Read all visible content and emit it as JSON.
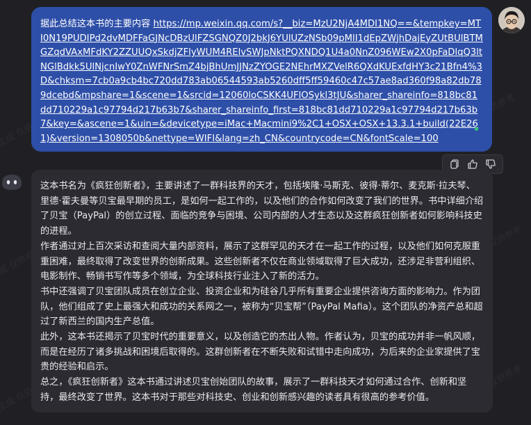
{
  "user_message": {
    "prompt": "据此总结这本书的主要内容 ",
    "url": "https://mp.weixin.qq.com/s?__biz=MzU2NjA4MDI1NQ==&tempkey=MTI0N19PUDIPd2dvMDFFaGJNcDBzUlFZSGNQZ0J2bkJ6YUlUZzNSb09pMlI1dEpZWjhDajEyZUtBUlBTMGZqdVAxMFdKY2ZZUUQxSkdjZFlyWUM4RElvSWJpNktPQXNDQ1U4a0NnZ096WEw2X0pFaDlqQ3ltNGlBdkk5UlNjcnIwY0ZnWFNrSmZ4bjBhUmJJNzZYOGE2NEhrMXZVelR6QXdKUExfdHY3c21Bfn4%3D&chksm=7cb0a9cb4bc720dd783ab06544593ab5260dff5ff59460c47c57ae8ad360f98a82db789dcebd&mpshare=1&scene=1&srcid=12060loCSKK4UFlOSykl3tJU&sharer_shareinfo=818bc81dd710229a1c97794d217b63b7&sharer_shareinfo_first=818bc81dd710229a1c97794d217b63b7&key=&ascene=1&uin=&devicetype=iMac+Macmini9%2C1+OSX+OSX+13.3.1+build(22E261)&version=1308050b&nettype=WIFI&lang=zh_CN&countrycode=CN&fontScale=100"
  },
  "bot_response": {
    "paragraphs": [
      "这本书名为《疯狂创新者》，主要讲述了一群科技界的天才，包括埃隆·马斯克、彼得·蒂尔、麦克斯·拉夫琴、里德·霍夫曼等贝宝最早期的员工，是如何一起工作的，以及他们的合作如何改变了我们的世界。书中详细介绍了贝宝（PayPal）的创立过程、面临的竞争与困境、公司内部的人才生态以及这群疯狂创新者如何影响科技史的进程。",
      "作者通过对上百次采访和查阅大量内部资料，展示了这群罕见的天才在一起工作的过程，以及他们如何克服重重困难，最终取得了改变世界的创新成果。这些创新者不仅在商业领域取得了巨大成功，还涉足非营利组织、电影制作、畅销书写作等多个领域，为全球科技行业注入了新的活力。",
      "书中还强调了贝宝团队成员在创立企业、投资企业和为硅谷几乎所有重要企业提供咨询方面的影响力。作为团队，他们组成了史上最强大和成功的关系网之一，被称为“贝宝帮”（PayPal Mafia）。这个团队的净资产总和超过了新西兰的国内生产总值。",
      "此外，这本书还揭示了贝宝时代的重要意义，以及创造它的杰出人物。作者认为，贝宝的成功并非一帆风顺，而是在经历了诸多挑战和困境后取得的。这群创新者在不断失败和试错中走向成功，为后来的企业家提供了宝贵的经验和启示。",
      "总之，《疯狂创新者》这本书通过讲述贝宝创始团队的故事，展示了一群科技天才如何通过合作、创新和坚持，最终改变了世界。这本书对于那些对科技史、创业和创新感兴趣的读者具有很高的参考价值。"
    ]
  },
  "actions": {
    "items": [
      "copy-icon",
      "thumbs-up-icon",
      "thumbs-down-icon"
    ]
  },
  "watermark": {
    "text": "AI生成 仅供参考"
  },
  "colors": {
    "background": "#202024",
    "user_bubble": "#2e4fa8",
    "bot_bubble": "#2b2b31",
    "text": "#e9e9ee",
    "online_dot": "#2ecc71"
  }
}
